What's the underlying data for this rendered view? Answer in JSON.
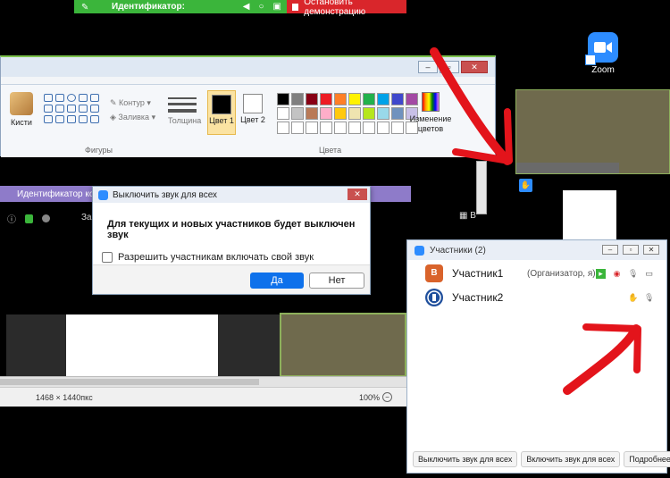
{
  "share_bar": {
    "id_label": "Идентификатор:",
    "stop_label": "Остановить демонстрацию"
  },
  "desktop": {
    "zoom_icon_label": "Zoom"
  },
  "paint": {
    "brushes_label": "Кисти",
    "shapes_group": "Фигуры",
    "outline_label": "Контур",
    "fill_label": "Заливка",
    "thickness_label": "Толщина",
    "color1_label": "Цвет 1",
    "color2_label": "Цвет 2",
    "colors_group": "Цвета",
    "edit_colors_label": "Изменение цветов",
    "status_dimensions": "1468 × 1440пкс",
    "zoom_level": "100%",
    "palette": [
      "#000000",
      "#7f7f7f",
      "#880015",
      "#ed1c24",
      "#ff7f27",
      "#fff200",
      "#22b14c",
      "#00a2e8",
      "#3f48cc",
      "#a349a4",
      "#ffffff",
      "#c3c3c3",
      "#b97a57",
      "#ffaec9",
      "#ffc90e",
      "#efe4b0",
      "#b5e61d",
      "#99d9ea",
      "#7092be",
      "#c8bfe7",
      "#ffffff",
      "#ffffff",
      "#ffffff",
      "#ffffff",
      "#ffffff",
      "#ffffff",
      "#ffffff",
      "#ffffff",
      "#ffffff",
      "#ffffff"
    ]
  },
  "meeting": {
    "window_title": "Идентификатор конф",
    "za_text": "За"
  },
  "dialog": {
    "title": "Выключить звук для всех",
    "message": "Для текущих и новых участников будет выключен звук",
    "checkbox_label": "Разрешить участникам включать свой звук",
    "yes_label": "Да",
    "no_label": "Нет"
  },
  "participants": {
    "title": "Участники (2)",
    "rows": [
      {
        "initial": "B",
        "name": "Участник1",
        "role": "(Организатор, я)",
        "color": "#d9632b"
      },
      {
        "initial": "",
        "name": "Участник2",
        "role": "",
        "color": "#1f4f9c"
      }
    ],
    "mute_all": "Выключить звук для всех",
    "unmute_all": "Включить звук для всех",
    "more": "Подробнее"
  },
  "colors": {
    "zoom_blue": "#2d8cff",
    "share_green": "#3bb53b",
    "share_red": "#d9262b",
    "annotation_red": "#e3141b"
  }
}
